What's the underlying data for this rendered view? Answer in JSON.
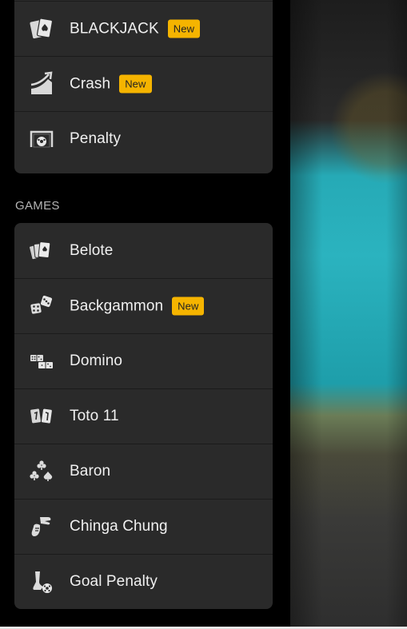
{
  "top_section": {
    "items": [
      {
        "label": "BLACKJACK",
        "badge": "New",
        "icon": "cards-icon"
      },
      {
        "label": "Crash",
        "badge": "New",
        "icon": "chart-rising-icon"
      },
      {
        "label": "Penalty",
        "badge": "",
        "icon": "goal-icon"
      }
    ]
  },
  "games_section": {
    "title": "GAMES",
    "items": [
      {
        "label": "Belote",
        "badge": "",
        "icon": "playing-cards-icon"
      },
      {
        "label": "Backgammon",
        "badge": "New",
        "icon": "dice-icon"
      },
      {
        "label": "Domino",
        "badge": "",
        "icon": "domino-icon"
      },
      {
        "label": "Toto 11",
        "badge": "",
        "icon": "toto-cards-icon"
      },
      {
        "label": "Baron",
        "badge": "",
        "icon": "card-suits-icon"
      },
      {
        "label": "Chinga Chung",
        "badge": "",
        "icon": "hand-gesture-icon"
      },
      {
        "label": "Goal Penalty",
        "badge": "",
        "icon": "kick-ball-icon"
      }
    ]
  },
  "colors": {
    "badge": "#f5b400",
    "card_bg": "#2a2a2a",
    "text": "#f0f0f0"
  }
}
